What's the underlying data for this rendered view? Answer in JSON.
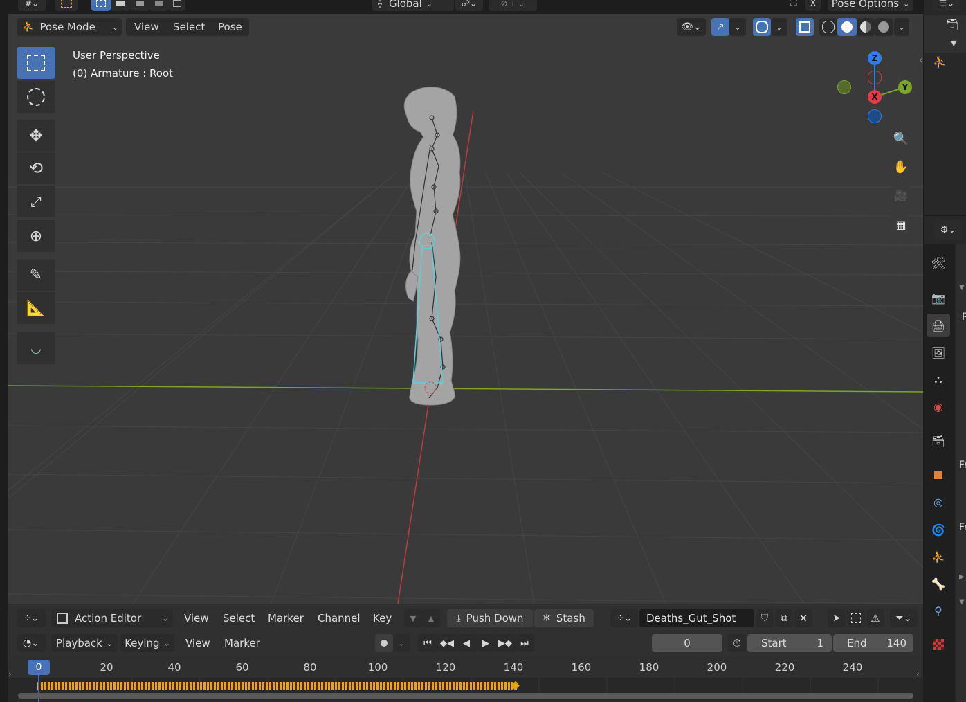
{
  "top_header": {
    "orientation_label": "Global",
    "pose_options_label": "Pose Options",
    "x_mirror_label": "X"
  },
  "viewport_header": {
    "mode_label": "Pose Mode",
    "menus": [
      "View",
      "Select",
      "Pose"
    ]
  },
  "viewport": {
    "perspective_label": "User Perspective",
    "object_label": "(0) Armature : Root",
    "gizmo": {
      "z": "Z",
      "y": "Y",
      "x": "X"
    },
    "colors": {
      "background": "#3a3a3a",
      "grid": "#444444",
      "x_axis": "#c0393b",
      "y_axis": "#7aa52a",
      "bone_select": "#5ecfd9"
    }
  },
  "toolbar": {
    "tools": [
      "select-box-icon",
      "cursor-icon",
      "move-icon",
      "rotate-icon",
      "scale-icon",
      "transform-icon",
      "annotate-icon",
      "measure-icon",
      "relax-pose-icon"
    ]
  },
  "action_editor": {
    "editor_label": "Action Editor",
    "menus": [
      "View",
      "Select",
      "Marker",
      "Channel",
      "Key"
    ],
    "push_down_label": "Push Down",
    "stash_label": "Stash",
    "action_name": "Deaths_Gut_Shot"
  },
  "timeline_header": {
    "playback_label": "Playback",
    "keying_label": "Keying",
    "menus": [
      "View",
      "Marker"
    ],
    "current_frame": "0",
    "start_label": "Start",
    "start_value": "1",
    "end_label": "End",
    "end_value": "140"
  },
  "timeline": {
    "playhead_label": "0",
    "ticks": [
      "20",
      "40",
      "60",
      "80",
      "100",
      "120",
      "140",
      "160",
      "180",
      "200",
      "220",
      "240"
    ],
    "keyframe_range": [
      0,
      140
    ],
    "colors": {
      "keyframe": "#e8a317",
      "playhead": "#4772b3"
    }
  },
  "properties_panel": {
    "tabs": [
      "tool-icon",
      "render-icon",
      "output-icon",
      "view-layer-icon",
      "scene-icon",
      "world-icon",
      "collection-icon",
      "object-icon",
      "modifiers-icon",
      "physics-icon",
      "object-data-armature-icon",
      "bone-icon",
      "bone-constraint-icon",
      "texture-icon"
    ],
    "cut_labels": [
      "R",
      "Fr",
      "Fr"
    ]
  }
}
